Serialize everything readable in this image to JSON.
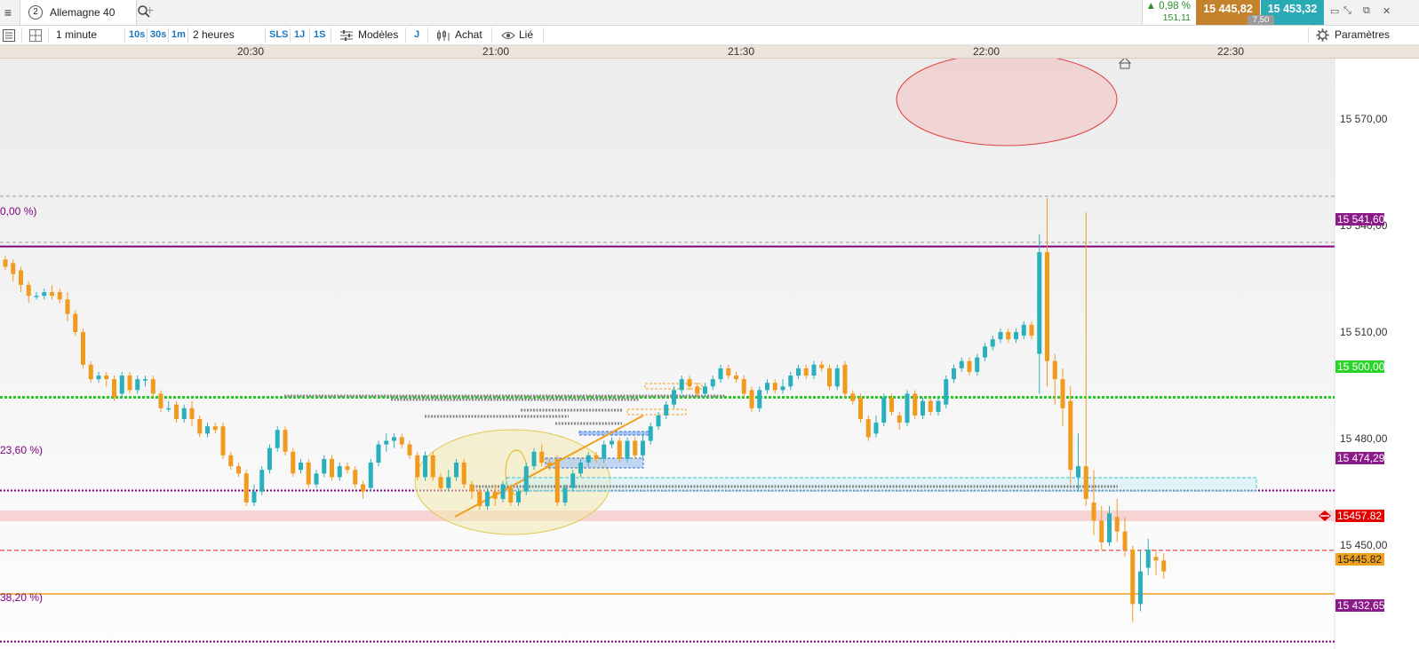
{
  "topbar": {
    "menu_icon": "hamburger-icon",
    "tab_number": "2",
    "instrument": "Allemagne 40",
    "search_icon": "search-icon",
    "add_icon": "plus-icon",
    "add_label": "+",
    "change_pct": "0,98 %",
    "change_arrow": "▲",
    "change_abs": "151,11",
    "bid": "15 445,82",
    "ask": "15 453,32",
    "spread": "7,50",
    "window_icons": [
      "expand-icon",
      "shrink-icon",
      "popout-icon",
      "close-icon"
    ]
  },
  "toolbar": {
    "list_icon": "list-icon",
    "layout_icon": "layout-icon",
    "timeframe": "1 minute",
    "quick_tf": [
      "10s",
      "30s",
      "1m"
    ],
    "range": "2 heures",
    "range_buttons": [
      "SLS",
      "1J",
      "1S"
    ],
    "models_label": "Modèles",
    "models_icon": "sliders-icon",
    "j_label": "J",
    "buy_label": "Achat",
    "buy_icon": "order-icon",
    "link_label": "Lié",
    "link_icon": "eye-icon",
    "settings_label": "Paramètres",
    "settings_icon": "gear-icon"
  },
  "chart_data": {
    "type": "candlestick",
    "instrument": "Allemagne 40",
    "timeframe": "1 minute",
    "x_ticks": [
      "20:30",
      "21:00",
      "21:30",
      "22:00",
      "22:30"
    ],
    "x_range": [
      "20:16",
      "22:48"
    ],
    "y_ticks": [
      "15 450,00",
      "15 480,00",
      "15 510,00",
      "15 540,00",
      "15 570,00"
    ],
    "y_tick_values": [
      15450,
      15480,
      15510,
      15540,
      15570
    ],
    "ylim": [
      15430.6,
      15593.4
    ],
    "fibonacci": [
      {
        "label": "0,00 %)",
        "price": 15541.6,
        "price_label": "15 541,60"
      },
      {
        "label": "23,60 %)",
        "price": 15474.29,
        "price_label": "15 474,29"
      },
      {
        "label": "38,20 %)",
        "price": 15432.65,
        "price_label": "15 432,65"
      }
    ],
    "horizontal_levels": [
      {
        "price": 15500.0,
        "label": "15 500,00",
        "style": "green-dotted",
        "color": "#22cc22"
      },
      {
        "price": 15457.82,
        "label": "15457.82",
        "style": "red-dashed",
        "color": "#e02020"
      },
      {
        "price": 15445.82,
        "label": "15445.82",
        "style": "orange-solid",
        "color": "#f0a020"
      }
    ],
    "candles": [
      {
        "t": 0,
        "o": 15538,
        "c": 15536,
        "h": 15539,
        "l": 15535
      },
      {
        "t": 1,
        "o": 15537,
        "c": 15534,
        "h": 15538,
        "l": 15532
      },
      {
        "t": 2,
        "o": 15535,
        "c": 15531,
        "h": 15536,
        "l": 15529
      },
      {
        "t": 3,
        "o": 15531,
        "c": 15528,
        "h": 15532,
        "l": 15526
      },
      {
        "t": 4,
        "o": 15528,
        "c": 15528,
        "h": 15529,
        "l": 15527
      },
      {
        "t": 5,
        "o": 15528,
        "c": 15529,
        "h": 15530,
        "l": 15527
      },
      {
        "t": 6,
        "o": 15529,
        "c": 15528,
        "h": 15531,
        "l": 15527
      },
      {
        "t": 7,
        "o": 15529,
        "c": 15527,
        "h": 15530,
        "l": 15526
      },
      {
        "t": 8,
        "o": 15527,
        "c": 15523,
        "h": 15529,
        "l": 15521
      },
      {
        "t": 9,
        "o": 15523,
        "c": 15518,
        "h": 15524,
        "l": 15517
      },
      {
        "t": 10,
        "o": 15518,
        "c": 15509,
        "h": 15519,
        "l": 15508
      },
      {
        "t": 11,
        "o": 15509,
        "c": 15505,
        "h": 15510,
        "l": 15504
      },
      {
        "t": 12,
        "o": 15505,
        "c": 15506,
        "h": 15507,
        "l": 15504
      },
      {
        "t": 13,
        "o": 15506,
        "c": 15505,
        "h": 15507,
        "l": 15503
      },
      {
        "t": 14,
        "o": 15505,
        "c": 15500,
        "h": 15506,
        "l": 15499
      },
      {
        "t": 15,
        "o": 15501,
        "c": 15506,
        "h": 15507,
        "l": 15500
      },
      {
        "t": 16,
        "o": 15506,
        "c": 15502,
        "h": 15507,
        "l": 15501
      },
      {
        "t": 17,
        "o": 15502,
        "c": 15505,
        "h": 15506,
        "l": 15501
      },
      {
        "t": 18,
        "o": 15505,
        "c": 15505,
        "h": 15506,
        "l": 15503
      },
      {
        "t": 19,
        "o": 15505,
        "c": 15501,
        "h": 15506,
        "l": 15500
      },
      {
        "t": 20,
        "o": 15501,
        "c": 15497,
        "h": 15502,
        "l": 15496
      },
      {
        "t": 21,
        "o": 15497,
        "c": 15497,
        "h": 15499,
        "l": 15496
      },
      {
        "t": 22,
        "o": 15498,
        "c": 15494,
        "h": 15499,
        "l": 15493
      },
      {
        "t": 23,
        "o": 15494,
        "c": 15497,
        "h": 15498,
        "l": 15493
      },
      {
        "t": 24,
        "o": 15497,
        "c": 15494,
        "h": 15499,
        "l": 15492
      },
      {
        "t": 25,
        "o": 15494,
        "c": 15490,
        "h": 15495,
        "l": 15489
      },
      {
        "t": 26,
        "o": 15490,
        "c": 15492,
        "h": 15493,
        "l": 15489
      },
      {
        "t": 27,
        "o": 15492,
        "c": 15491,
        "h": 15493,
        "l": 15490
      },
      {
        "t": 28,
        "o": 15492,
        "c": 15484,
        "h": 15493,
        "l": 15483
      },
      {
        "t": 29,
        "o": 15484,
        "c": 15481,
        "h": 15485,
        "l": 15480
      },
      {
        "t": 30,
        "o": 15481,
        "c": 15479,
        "h": 15482,
        "l": 15478
      },
      {
        "t": 31,
        "o": 15479,
        "c": 15471,
        "h": 15480,
        "l": 15470
      },
      {
        "t": 32,
        "o": 15471,
        "c": 15474,
        "h": 15476,
        "l": 15470
      },
      {
        "t": 33,
        "o": 15474,
        "c": 15480,
        "h": 15481,
        "l": 15473
      },
      {
        "t": 34,
        "o": 15480,
        "c": 15486,
        "h": 15487,
        "l": 15479
      },
      {
        "t": 35,
        "o": 15486,
        "c": 15491,
        "h": 15492,
        "l": 15485
      },
      {
        "t": 36,
        "o": 15491,
        "c": 15485,
        "h": 15492,
        "l": 15484
      },
      {
        "t": 37,
        "o": 15485,
        "c": 15479,
        "h": 15486,
        "l": 15478
      },
      {
        "t": 38,
        "o": 15480,
        "c": 15482,
        "h": 15483,
        "l": 15479
      },
      {
        "t": 39,
        "o": 15482,
        "c": 15476,
        "h": 15483,
        "l": 15475
      },
      {
        "t": 40,
        "o": 15476,
        "c": 15479,
        "h": 15480,
        "l": 15475
      },
      {
        "t": 41,
        "o": 15479,
        "c": 15483,
        "h": 15484,
        "l": 15478
      },
      {
        "t": 42,
        "o": 15483,
        "c": 15478,
        "h": 15484,
        "l": 15477
      },
      {
        "t": 43,
        "o": 15478,
        "c": 15481,
        "h": 15482,
        "l": 15477
      },
      {
        "t": 44,
        "o": 15481,
        "c": 15480,
        "h": 15482,
        "l": 15479
      },
      {
        "t": 45,
        "o": 15480,
        "c": 15476,
        "h": 15481,
        "l": 15475
      },
      {
        "t": 46,
        "o": 15476,
        "c": 15474,
        "h": 15477,
        "l": 15472
      },
      {
        "t": 47,
        "o": 15475,
        "c": 15482,
        "h": 15483,
        "l": 15474
      },
      {
        "t": 48,
        "o": 15482,
        "c": 15487,
        "h": 15488,
        "l": 15481
      },
      {
        "t": 49,
        "o": 15487,
        "c": 15488,
        "h": 15490,
        "l": 15485
      },
      {
        "t": 50,
        "o": 15488,
        "c": 15489,
        "h": 15490,
        "l": 15486
      },
      {
        "t": 51,
        "o": 15489,
        "c": 15487,
        "h": 15490,
        "l": 15486
      },
      {
        "t": 52,
        "o": 15487,
        "c": 15484,
        "h": 15488,
        "l": 15483
      },
      {
        "t": 53,
        "o": 15484,
        "c": 15478,
        "h": 15485,
        "l": 15477
      },
      {
        "t": 54,
        "o": 15478,
        "c": 15484,
        "h": 15485,
        "l": 15477
      },
      {
        "t": 55,
        "o": 15484,
        "c": 15478,
        "h": 15485,
        "l": 15477
      },
      {
        "t": 56,
        "o": 15478,
        "c": 15475,
        "h": 15479,
        "l": 15474
      },
      {
        "t": 57,
        "o": 15475,
        "c": 15478,
        "h": 15480,
        "l": 15474
      },
      {
        "t": 58,
        "o": 15478,
        "c": 15482,
        "h": 15483,
        "l": 15477
      },
      {
        "t": 59,
        "o": 15482,
        "c": 15476,
        "h": 15483,
        "l": 15475
      },
      {
        "t": 60,
        "o": 15476,
        "c": 15474,
        "h": 15477,
        "l": 15472
      },
      {
        "t": 61,
        "o": 15474,
        "c": 15470,
        "h": 15475,
        "l": 15469
      },
      {
        "t": 62,
        "o": 15470,
        "c": 15474,
        "h": 15475,
        "l": 15469
      },
      {
        "t": 63,
        "o": 15474,
        "c": 15472,
        "h": 15476,
        "l": 15470
      },
      {
        "t": 64,
        "o": 15472,
        "c": 15476,
        "h": 15477,
        "l": 15471
      },
      {
        "t": 65,
        "o": 15475,
        "c": 15471,
        "h": 15476,
        "l": 15470
      },
      {
        "t": 66,
        "o": 15471,
        "c": 15474,
        "h": 15475,
        "l": 15470
      },
      {
        "t": 67,
        "o": 15474,
        "c": 15481,
        "h": 15482,
        "l": 15473
      },
      {
        "t": 68,
        "o": 15481,
        "c": 15485,
        "h": 15486,
        "l": 15480
      },
      {
        "t": 69,
        "o": 15485,
        "c": 15482,
        "h": 15487,
        "l": 15481
      },
      {
        "t": 70,
        "o": 15482,
        "c": 15481,
        "h": 15483,
        "l": 15480
      },
      {
        "t": 71,
        "o": 15483,
        "c": 15471,
        "h": 15484,
        "l": 15470
      },
      {
        "t": 72,
        "o": 15471,
        "c": 15475,
        "h": 15476,
        "l": 15470
      },
      {
        "t": 73,
        "o": 15475,
        "c": 15479,
        "h": 15480,
        "l": 15474
      },
      {
        "t": 74,
        "o": 15479,
        "c": 15482,
        "h": 15483,
        "l": 15478
      },
      {
        "t": 75,
        "o": 15482,
        "c": 15484,
        "h": 15485,
        "l": 15481
      },
      {
        "t": 76,
        "o": 15484,
        "c": 15483,
        "h": 15485,
        "l": 15482
      },
      {
        "t": 77,
        "o": 15483,
        "c": 15487,
        "h": 15488,
        "l": 15482
      },
      {
        "t": 78,
        "o": 15487,
        "c": 15488,
        "h": 15489,
        "l": 15486
      },
      {
        "t": 79,
        "o": 15488,
        "c": 15483,
        "h": 15489,
        "l": 15482
      },
      {
        "t": 80,
        "o": 15483,
        "c": 15488,
        "h": 15489,
        "l": 15482
      },
      {
        "t": 81,
        "o": 15488,
        "c": 15484,
        "h": 15489,
        "l": 15483
      },
      {
        "t": 82,
        "o": 15484,
        "c": 15488,
        "h": 15490,
        "l": 15483
      },
      {
        "t": 83,
        "o": 15488,
        "c": 15492,
        "h": 15493,
        "l": 15487
      },
      {
        "t": 84,
        "o": 15492,
        "c": 15495,
        "h": 15496,
        "l": 15491
      },
      {
        "t": 85,
        "o": 15495,
        "c": 15498,
        "h": 15499,
        "l": 15494
      },
      {
        "t": 86,
        "o": 15498,
        "c": 15502,
        "h": 15503,
        "l": 15497
      },
      {
        "t": 87,
        "o": 15502,
        "c": 15505,
        "h": 15506,
        "l": 15501
      },
      {
        "t": 88,
        "o": 15505,
        "c": 15503,
        "h": 15506,
        "l": 15502
      },
      {
        "t": 89,
        "o": 15503,
        "c": 15501,
        "h": 15504,
        "l": 15500
      },
      {
        "t": 90,
        "o": 15501,
        "c": 15503,
        "h": 15504,
        "l": 15500
      },
      {
        "t": 91,
        "o": 15503,
        "c": 15505,
        "h": 15506,
        "l": 15502
      },
      {
        "t": 92,
        "o": 15505,
        "c": 15508,
        "h": 15509,
        "l": 15504
      },
      {
        "t": 93,
        "o": 15508,
        "c": 15506,
        "h": 15509,
        "l": 15505
      },
      {
        "t": 94,
        "o": 15506,
        "c": 15505,
        "h": 15507,
        "l": 15504
      },
      {
        "t": 95,
        "o": 15505,
        "c": 15501,
        "h": 15506,
        "l": 15500
      },
      {
        "t": 96,
        "o": 15502,
        "c": 15497,
        "h": 15503,
        "l": 15496
      },
      {
        "t": 97,
        "o": 15497,
        "c": 15502,
        "h": 15503,
        "l": 15496
      },
      {
        "t": 98,
        "o": 15502,
        "c": 15504,
        "h": 15505,
        "l": 15501
      },
      {
        "t": 99,
        "o": 15504,
        "c": 15502,
        "h": 15505,
        "l": 15501
      },
      {
        "t": 100,
        "o": 15502,
        "c": 15503,
        "h": 15505,
        "l": 15501
      },
      {
        "t": 101,
        "o": 15503,
        "c": 15506,
        "h": 15507,
        "l": 15502
      },
      {
        "t": 102,
        "o": 15506,
        "c": 15508,
        "h": 15509,
        "l": 15505
      },
      {
        "t": 103,
        "o": 15508,
        "c": 15506,
        "h": 15509,
        "l": 15505
      },
      {
        "t": 104,
        "o": 15506,
        "c": 15509,
        "h": 15510,
        "l": 15505
      },
      {
        "t": 105,
        "o": 15509,
        "c": 15508,
        "h": 15510,
        "l": 15507
      },
      {
        "t": 106,
        "o": 15508,
        "c": 15503,
        "h": 15509,
        "l": 15502
      },
      {
        "t": 107,
        "o": 15503,
        "c": 15508,
        "h": 15509,
        "l": 15502
      },
      {
        "t": 108,
        "o": 15509,
        "c": 15501,
        "h": 15510,
        "l": 15500
      },
      {
        "t": 109,
        "o": 15501,
        "c": 15499,
        "h": 15502,
        "l": 15498
      },
      {
        "t": 110,
        "o": 15500,
        "c": 15494,
        "h": 15501,
        "l": 15493
      },
      {
        "t": 111,
        "o": 15494,
        "c": 15489,
        "h": 15495,
        "l": 15488
      },
      {
        "t": 112,
        "o": 15490,
        "c": 15493,
        "h": 15495,
        "l": 15489
      },
      {
        "t": 113,
        "o": 15493,
        "c": 15500,
        "h": 15501,
        "l": 15492
      },
      {
        "t": 114,
        "o": 15500,
        "c": 15496,
        "h": 15501,
        "l": 15495
      },
      {
        "t": 115,
        "o": 15495,
        "c": 15493,
        "h": 15496,
        "l": 15491
      },
      {
        "t": 116,
        "o": 15493,
        "c": 15501,
        "h": 15502,
        "l": 15492
      },
      {
        "t": 117,
        "o": 15501,
        "c": 15495,
        "h": 15502,
        "l": 15494
      },
      {
        "t": 118,
        "o": 15495,
        "c": 15499,
        "h": 15500,
        "l": 15494
      },
      {
        "t": 119,
        "o": 15499,
        "c": 15496,
        "h": 15500,
        "l": 15495
      },
      {
        "t": 120,
        "o": 15496,
        "c": 15499,
        "h": 15500,
        "l": 15495
      },
      {
        "t": 121,
        "o": 15498,
        "c": 15505,
        "h": 15506,
        "l": 15497
      },
      {
        "t": 122,
        "o": 15505,
        "c": 15508,
        "h": 15509,
        "l": 15504
      },
      {
        "t": 123,
        "o": 15508,
        "c": 15510,
        "h": 15511,
        "l": 15507
      },
      {
        "t": 124,
        "o": 15510,
        "c": 15507,
        "h": 15511,
        "l": 15506
      },
      {
        "t": 125,
        "o": 15507,
        "c": 15511,
        "h": 15512,
        "l": 15506
      },
      {
        "t": 126,
        "o": 15511,
        "c": 15514,
        "h": 15515,
        "l": 15510
      },
      {
        "t": 127,
        "o": 15514,
        "c": 15516,
        "h": 15517,
        "l": 15513
      },
      {
        "t": 128,
        "o": 15516,
        "c": 15518,
        "h": 15519,
        "l": 15515
      },
      {
        "t": 129,
        "o": 15518,
        "c": 15516,
        "h": 15519,
        "l": 15515
      },
      {
        "t": 130,
        "o": 15516,
        "c": 15518,
        "h": 15519,
        "l": 15515
      },
      {
        "t": 131,
        "o": 15517,
        "c": 15520,
        "h": 15521,
        "l": 15516
      },
      {
        "t": 132,
        "o": 15520,
        "c": 15517,
        "h": 15521,
        "l": 15516
      },
      {
        "t": 133,
        "o": 15512,
        "c": 15540,
        "h": 15545,
        "l": 15501
      },
      {
        "t": 134,
        "o": 15540,
        "c": 15510,
        "h": 15555,
        "l": 15503
      },
      {
        "t": 135,
        "o": 15510,
        "c": 15505,
        "h": 15512,
        "l": 15498
      },
      {
        "t": 136,
        "o": 15505,
        "c": 15497,
        "h": 15508,
        "l": 15492
      },
      {
        "t": 137,
        "o": 15499,
        "c": 15480,
        "h": 15503,
        "l": 15476
      },
      {
        "t": 138,
        "o": 15478,
        "c": 15481,
        "h": 15490,
        "l": 15474
      },
      {
        "t": 139,
        "o": 15481,
        "c": 15472,
        "h": 15551,
        "l": 15470
      },
      {
        "t": 140,
        "o": 15471,
        "c": 15466,
        "h": 15480,
        "l": 15462
      },
      {
        "t": 141,
        "o": 15466,
        "c": 15460,
        "h": 15470,
        "l": 15458
      },
      {
        "t": 142,
        "o": 15460,
        "c": 15468,
        "h": 15470,
        "l": 15459
      },
      {
        "t": 143,
        "o": 15467,
        "c": 15463,
        "h": 15472,
        "l": 15460
      },
      {
        "t": 144,
        "o": 15463,
        "c": 15458,
        "h": 15467,
        "l": 15456
      },
      {
        "t": 145,
        "o": 15458,
        "c": 15443,
        "h": 15459,
        "l": 15438
      },
      {
        "t": 146,
        "o": 15443,
        "c": 15452,
        "h": 15458,
        "l": 15441
      },
      {
        "t": 147,
        "o": 15453,
        "c": 15458,
        "h": 15461,
        "l": 15451
      },
      {
        "t": 148,
        "o": 15456,
        "c": 15455,
        "h": 15458,
        "l": 15451
      },
      {
        "t": 149,
        "o": 15455,
        "c": 15452,
        "h": 15457,
        "l": 15450
      }
    ]
  },
  "colors": {
    "bull": "#2ab0bd",
    "bear": "#f09a1e",
    "fib": "#800080",
    "fib_label_bg": "#8b1a8b",
    "green_label_bg": "#2ad42a",
    "red_label_bg": "#e00000",
    "orange_label_bg": "#f0a020"
  },
  "chart_tools": {
    "home_icon": "house-icon",
    "order_handle_icon": "order-handle-icon"
  }
}
